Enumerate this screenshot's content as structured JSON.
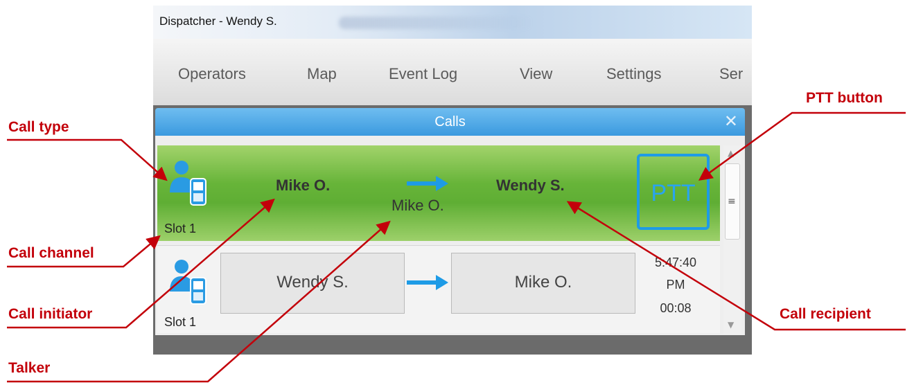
{
  "window": {
    "title": "Dispatcher - Wendy S."
  },
  "menu": {
    "items": [
      "Operators",
      "Map",
      "Event Log",
      "View",
      "Settings",
      "Ser"
    ]
  },
  "calls_panel": {
    "title": "Calls",
    "close_glyph": "✕",
    "scroll_up_glyph": "▲",
    "scroll_down_glyph": "▼",
    "thumb_glyph": "≡",
    "active_call": {
      "initiator": "Mike O.",
      "talker": "Mike O.",
      "recipient": "Wendy S.",
      "slot": "Slot 1",
      "ptt_label": "PTT",
      "call_type_icon": "private-radio-call-icon",
      "direction_icon": "arrow-right-icon"
    },
    "recent_call": {
      "initiator": "Wendy S.",
      "recipient": "Mike O.",
      "slot": "Slot 1",
      "time_line1": "5:47:40",
      "time_line2": "PM",
      "duration": "00:08",
      "call_type_icon": "private-radio-call-icon",
      "direction_icon": "arrow-right-icon"
    }
  },
  "annotations": {
    "call_type": "Call type",
    "call_channel": "Call channel",
    "call_initiator": "Call initiator",
    "talker": "Talker",
    "ptt_button": "PTT button",
    "call_recipient": "Call recipient"
  },
  "colors": {
    "accent_blue": "#2aa4ee",
    "header_blue": "#3b9adf",
    "active_green": "#67b439",
    "annotation_red": "#c3000a"
  }
}
